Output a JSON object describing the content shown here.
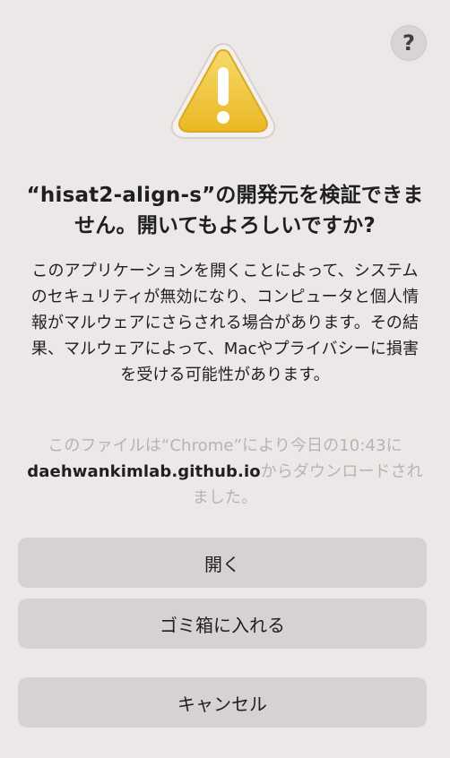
{
  "dialog": {
    "title": "“hisat2-align-s”の開発元を検証できません。開いてもよろしいですか?",
    "message": "このアプリケーションを開くことによって、システムのセキュリティが無効になり、コンピュータと個人情報がマルウェアにさらされる場合があります。その結果、マルウェアによって、Macやプライバシーに損害を受ける可能性があります。",
    "source": {
      "prefix": "このファイルは“Chrome”により今日の10:43に",
      "domain": "daehwankimlab.github.io",
      "suffix": "からダウンロードされました。"
    },
    "buttons": {
      "open": "開く",
      "move_to_trash": "ゴミ箱に入れる",
      "cancel": "キャンセル"
    },
    "help_label": "?"
  },
  "icons": {
    "help": "question-mark-icon",
    "warning": "warning-triangle-icon"
  },
  "colors": {
    "background": "#ece8e7",
    "button": "#d6d2d1",
    "warning_fill": "#f2c94c",
    "text": "#1f1f1f",
    "muted_text": "#b7b3b2"
  }
}
